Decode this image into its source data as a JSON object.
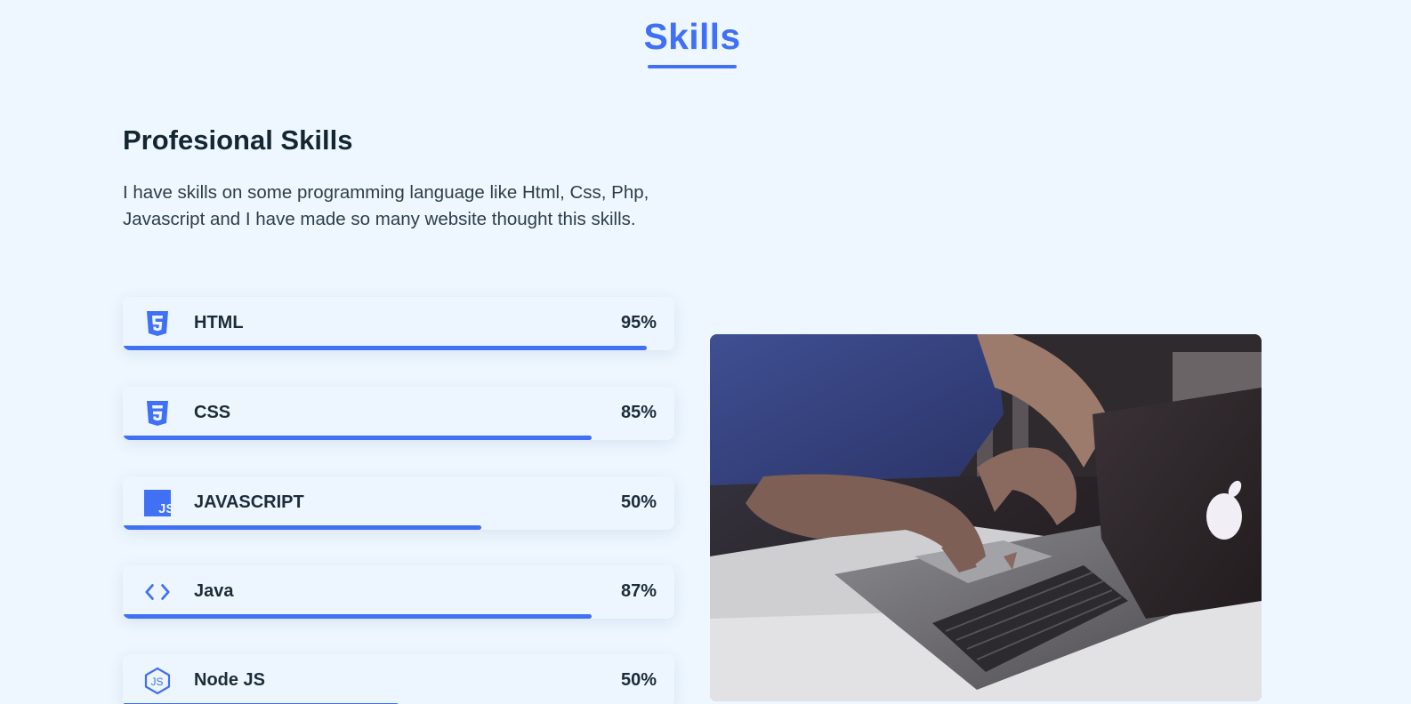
{
  "section": {
    "title": "Skills"
  },
  "intro": {
    "heading": "Profesional Skills",
    "description": "I have skills on some programming language like Html, Css, Php, Javascript and I have made so many website thought this skills."
  },
  "skills": [
    {
      "name": "HTML",
      "percent_label": "95%",
      "level": 0.95,
      "icon": "html5-icon"
    },
    {
      "name": "CSS",
      "percent_label": "85%",
      "level": 0.85,
      "icon": "css3-icon"
    },
    {
      "name": "JAVASCRIPT",
      "percent_label": "50%",
      "level": 0.65,
      "icon": "js-icon"
    },
    {
      "name": "Java",
      "percent_label": "87%",
      "level": 0.85,
      "icon": "code-brackets-icon"
    },
    {
      "name": "Node JS",
      "percent_label": "50%",
      "level": 0.5,
      "icon": "nodejs-icon"
    }
  ],
  "image": {
    "subject": "person-typing-on-laptop-photo"
  },
  "colors": {
    "accent": "#4070f4",
    "background": "#eef7ff",
    "heading": "#132631"
  }
}
